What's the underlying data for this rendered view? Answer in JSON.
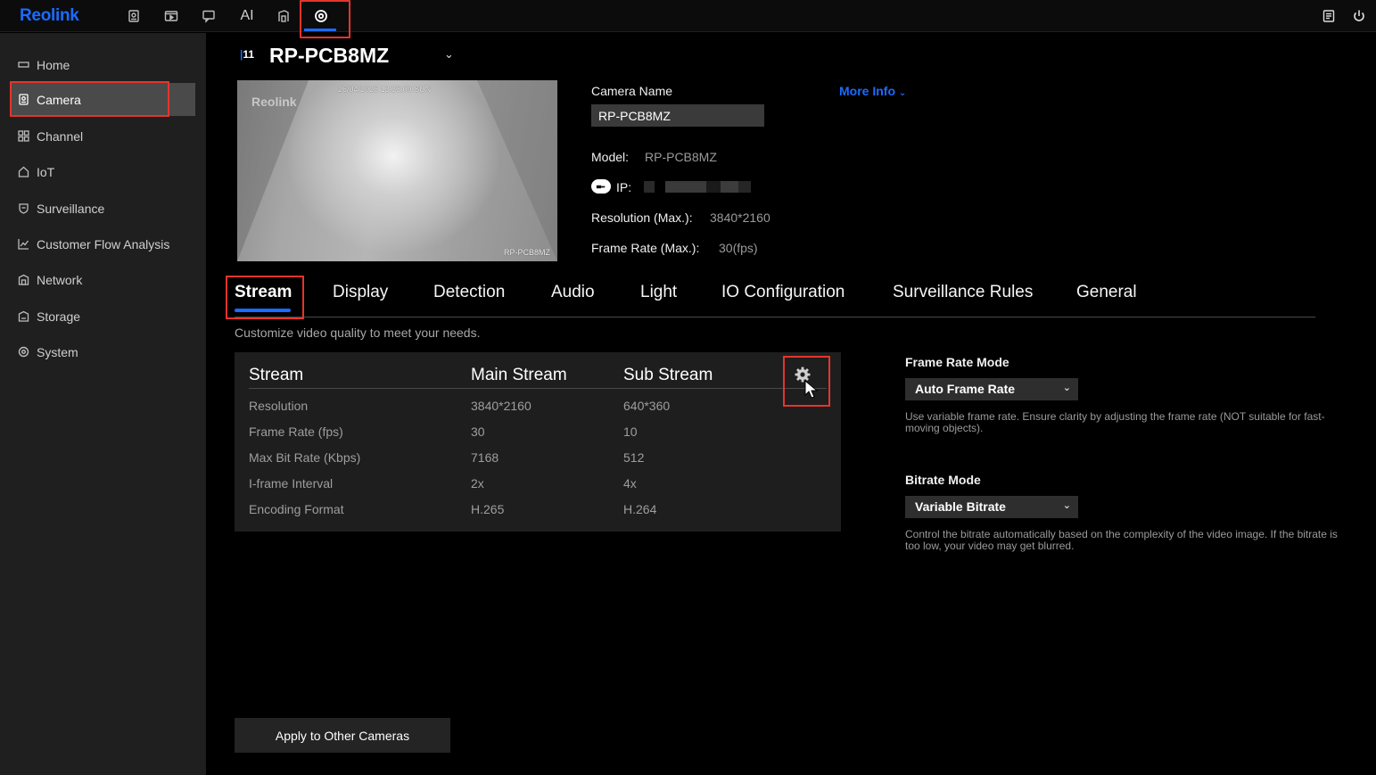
{
  "app": {
    "logo": "Reolink",
    "top_icons": [
      "preview-icon",
      "playback-icon",
      "message-icon",
      "ai-icon",
      "device-icon",
      "settings-icon",
      "log-icon",
      "power-icon"
    ],
    "ai_label": "AI"
  },
  "sidebar": {
    "items": [
      {
        "label": "Home",
        "icon": "home-icon"
      },
      {
        "label": "Camera",
        "icon": "camera-icon",
        "selected": true
      },
      {
        "label": "Channel",
        "icon": "channel-icon"
      },
      {
        "label": "IoT",
        "icon": "iot-icon"
      },
      {
        "label": "Surveillance",
        "icon": "shield-icon"
      },
      {
        "label": "Customer Flow Analysis",
        "icon": "chart-icon"
      },
      {
        "label": "Network",
        "icon": "network-icon"
      },
      {
        "label": "Storage",
        "icon": "storage-icon"
      },
      {
        "label": "System",
        "icon": "system-icon"
      }
    ]
  },
  "header": {
    "channel": "11",
    "camera_title": "RP-PCB8MZ"
  },
  "preview": {
    "timestamp": "26/04/2026 13:36:09 SUN",
    "watermark": "Reolink",
    "name_overlay": "RP-PCB8MZ"
  },
  "info": {
    "camera_name_label": "Camera Name",
    "camera_name_value": "RP-PCB8MZ",
    "more_info": "More Info",
    "model_label": "Model:",
    "model_value": "RP-PCB8MZ",
    "ip_label": "IP:",
    "resolution_label": "Resolution (Max.):",
    "resolution_value": "3840*2160",
    "framerate_label": "Frame Rate (Max.):",
    "framerate_value": "30(fps)"
  },
  "tabs": [
    "Stream",
    "Display",
    "Detection",
    "Audio",
    "Light",
    "IO Configuration",
    "Surveillance Rules",
    "General"
  ],
  "stream": {
    "description": "Customize video quality to meet your needs.",
    "headers": [
      "Stream",
      "Main Stream",
      "Sub Stream"
    ],
    "rows": [
      {
        "label": "Resolution",
        "main": "3840*2160",
        "sub": "640*360"
      },
      {
        "label": "Frame Rate (fps)",
        "main": "30",
        "sub": "10"
      },
      {
        "label": "Max Bit Rate (Kbps)",
        "main": "7168",
        "sub": "512"
      },
      {
        "label": "I-frame Interval",
        "main": "2x",
        "sub": "4x"
      },
      {
        "label": "Encoding Format",
        "main": "H.265",
        "sub": "H.264"
      }
    ]
  },
  "right": {
    "frame_rate_mode_title": "Frame Rate Mode",
    "frame_rate_mode_value": "Auto Frame Rate",
    "frame_rate_mode_hint": "Use variable frame rate. Ensure clarity by adjusting the frame rate (NOT suitable for fast-moving objects).",
    "bitrate_mode_title": "Bitrate Mode",
    "bitrate_mode_value": "Variable Bitrate",
    "bitrate_mode_hint": "Control the bitrate automatically based on the complexity of the video image. If the bitrate is too low, your video may get blurred."
  },
  "apply_button": "Apply to Other Cameras",
  "colors": {
    "accent": "#1b6bff",
    "highlight": "#e5352b",
    "sidebar_bg": "#1f1f1f",
    "selected_bg": "#4a4a4a"
  }
}
